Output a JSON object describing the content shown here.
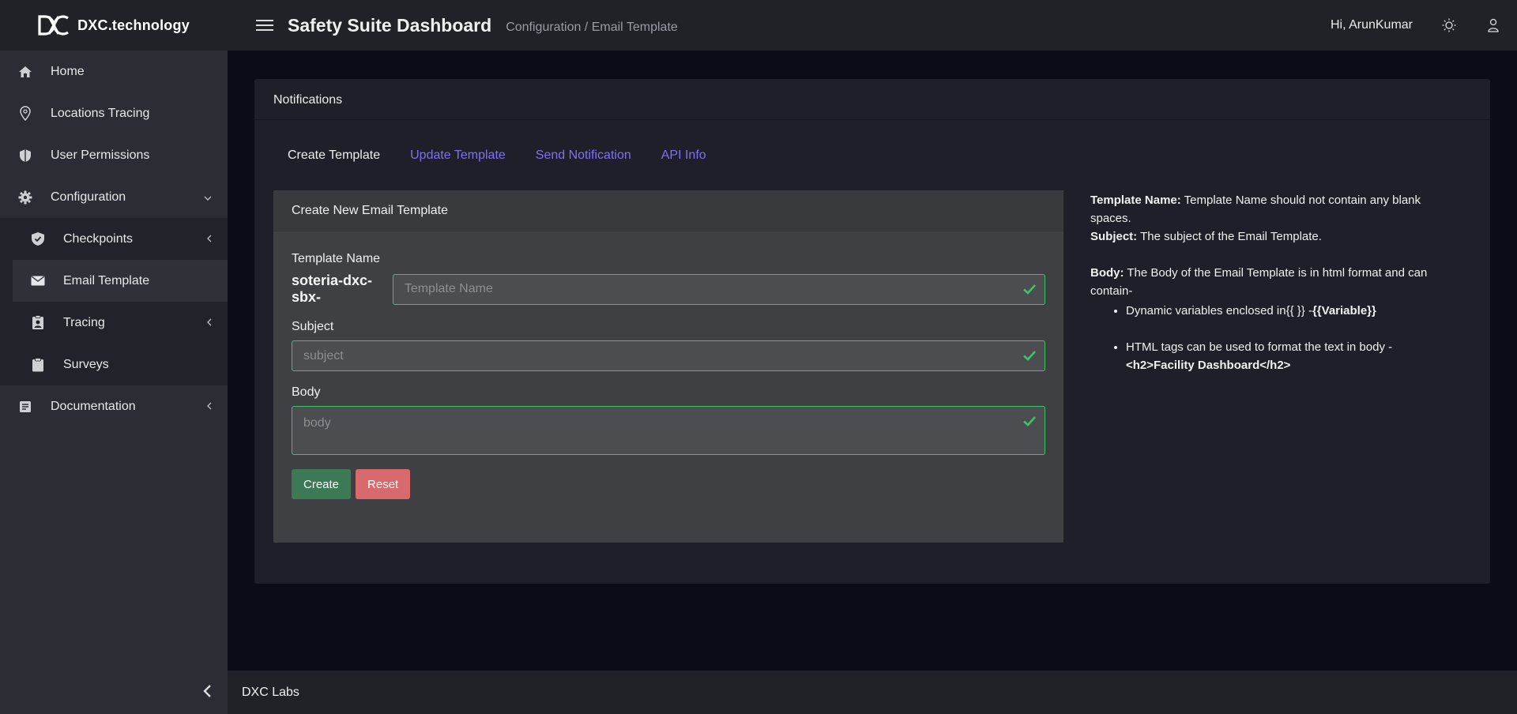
{
  "brand": {
    "name": "DXC.technology"
  },
  "header": {
    "title": "Safety Suite Dashboard",
    "breadcrumb": "Configuration / Email Template",
    "greeting": "Hi, ArunKumar"
  },
  "sidebar": {
    "items": [
      {
        "label": "Home",
        "icon": "home-icon"
      },
      {
        "label": "Locations Tracing",
        "icon": "map-pin-icon"
      },
      {
        "label": "User Permissions",
        "icon": "shield-icon"
      },
      {
        "label": "Configuration",
        "icon": "gear-icon"
      },
      {
        "label": "Documentation",
        "icon": "document-icon"
      }
    ],
    "subitems": [
      {
        "label": "Checkpoints",
        "icon": "shield-check-icon"
      },
      {
        "label": "Email Template",
        "icon": "envelope-icon"
      },
      {
        "label": "Tracing",
        "icon": "id-badge-icon"
      },
      {
        "label": "Surveys",
        "icon": "clipboard-icon"
      }
    ]
  },
  "card": {
    "title": "Notifications",
    "tabs": [
      "Create Template",
      "Update Template",
      "Send Notification",
      "API Info"
    ]
  },
  "form": {
    "title": "Create New Email Template",
    "template_name_label": "Template Name",
    "prefix": "soteria-dxc-sbx-",
    "template_name_placeholder": "Template Name",
    "subject_label": "Subject",
    "subject_placeholder": "subject",
    "body_label": "Body",
    "body_placeholder": "body",
    "create_label": "Create",
    "reset_label": "Reset"
  },
  "help": {
    "template_name_key": "Template Name:",
    "template_name_text": " Template Name should not contain any blank spaces.",
    "subject_key": "Subject:",
    "subject_text": " The subject of the Email Template.",
    "body_key": "Body:",
    "body_text": " The Body of the Email Template is in html format and can contain-",
    "bullet1_text": "Dynamic variables enclosed in{{ }} -",
    "bullet1_bold": "{{Variable}}",
    "bullet2_text": "HTML tags can be used to format the text in body -",
    "bullet2_bold": "<h2>Facility Dashboard</h2>"
  },
  "footer": {
    "text": "DXC Labs"
  },
  "colors": {
    "accent": "#7f72ee",
    "success": "#3ec26a",
    "create": "#3c7a55",
    "reset": "#d86a6d"
  }
}
